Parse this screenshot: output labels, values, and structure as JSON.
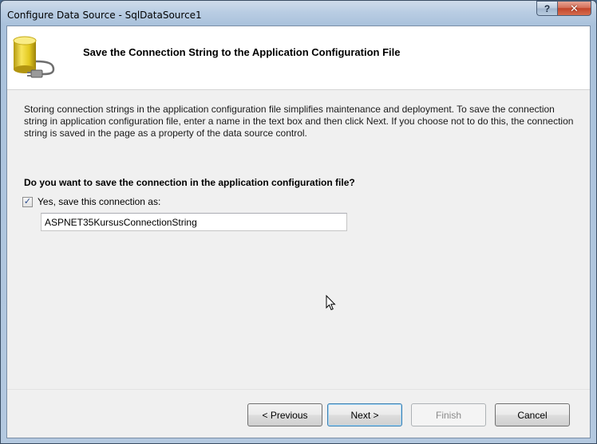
{
  "window": {
    "title": "Configure Data Source - SqlDataSource1",
    "help_label": "?",
    "close_label": "✕"
  },
  "header": {
    "title": "Save the Connection String to the Application Configuration File",
    "icon": "database-plug-icon"
  },
  "body": {
    "description": "Storing connection strings in the application configuration file simplifies maintenance and deployment. To save the connection string in application configuration file, enter a name in the text box and then click Next. If you choose not to do this, the connection string is saved in the page as a property of the data source control.",
    "question": "Do you want to save the connection in the application configuration file?",
    "save_checkbox": {
      "label": "Yes, save this connection as:",
      "checked": true,
      "mark": "✓"
    },
    "connection_name": {
      "value": "ASPNET35KursusConnectionString"
    }
  },
  "buttons": {
    "previous": "< Previous",
    "next": "Next >",
    "finish": "Finish",
    "cancel": "Cancel"
  },
  "colors": {
    "accent": "#3c7fb1",
    "database_yellow": "#e9d22b"
  }
}
